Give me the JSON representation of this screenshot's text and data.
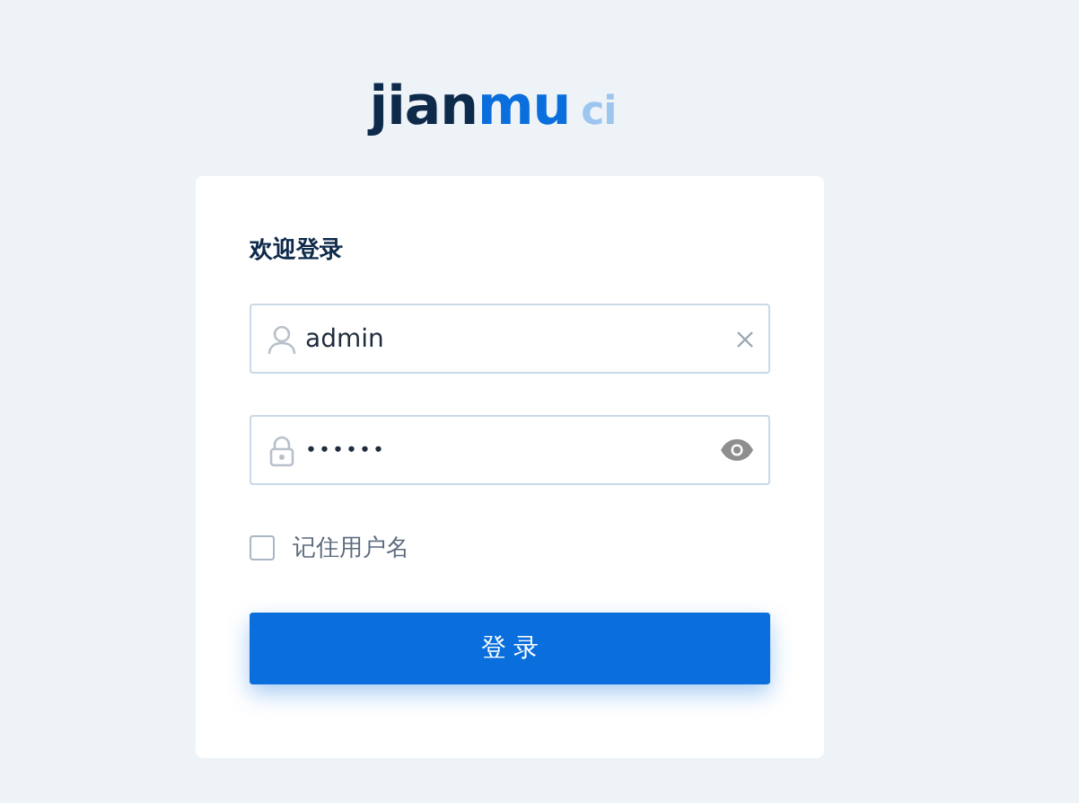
{
  "logo": {
    "primary": "jian",
    "accent": "mu",
    "suffix": "ci"
  },
  "form": {
    "title": "欢迎登录",
    "username": {
      "value": "admin"
    },
    "password": {
      "value": "••••••"
    },
    "remember": {
      "label": "记住用户名",
      "checked": false
    },
    "submit": "登 录"
  }
}
